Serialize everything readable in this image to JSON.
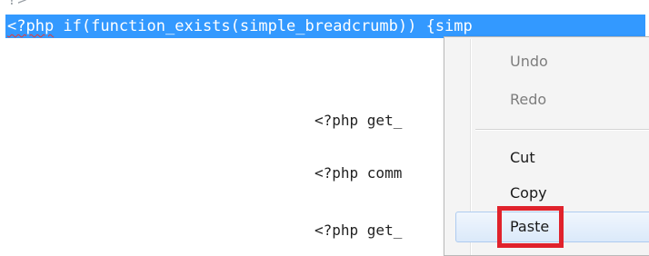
{
  "editor": {
    "top_fragment": "?>",
    "selected_line": {
      "prefix": "<?php",
      "rest": " if(function_exists(simple_breadcrumb)) {simp"
    },
    "lines": [
      "<?php get_",
      "<?php comm",
      "<?php get_"
    ],
    "selection_color": "#3399ff"
  },
  "context_menu": {
    "items": [
      {
        "label": "Undo",
        "enabled": false
      },
      {
        "label": "Redo",
        "enabled": false
      },
      {
        "label": "Cut",
        "enabled": true
      },
      {
        "label": "Copy",
        "enabled": true
      },
      {
        "label": "Paste",
        "enabled": true,
        "hovered": true
      }
    ]
  },
  "annotation": {
    "highlight_target": "Paste",
    "highlight_color": "#e0222c"
  }
}
